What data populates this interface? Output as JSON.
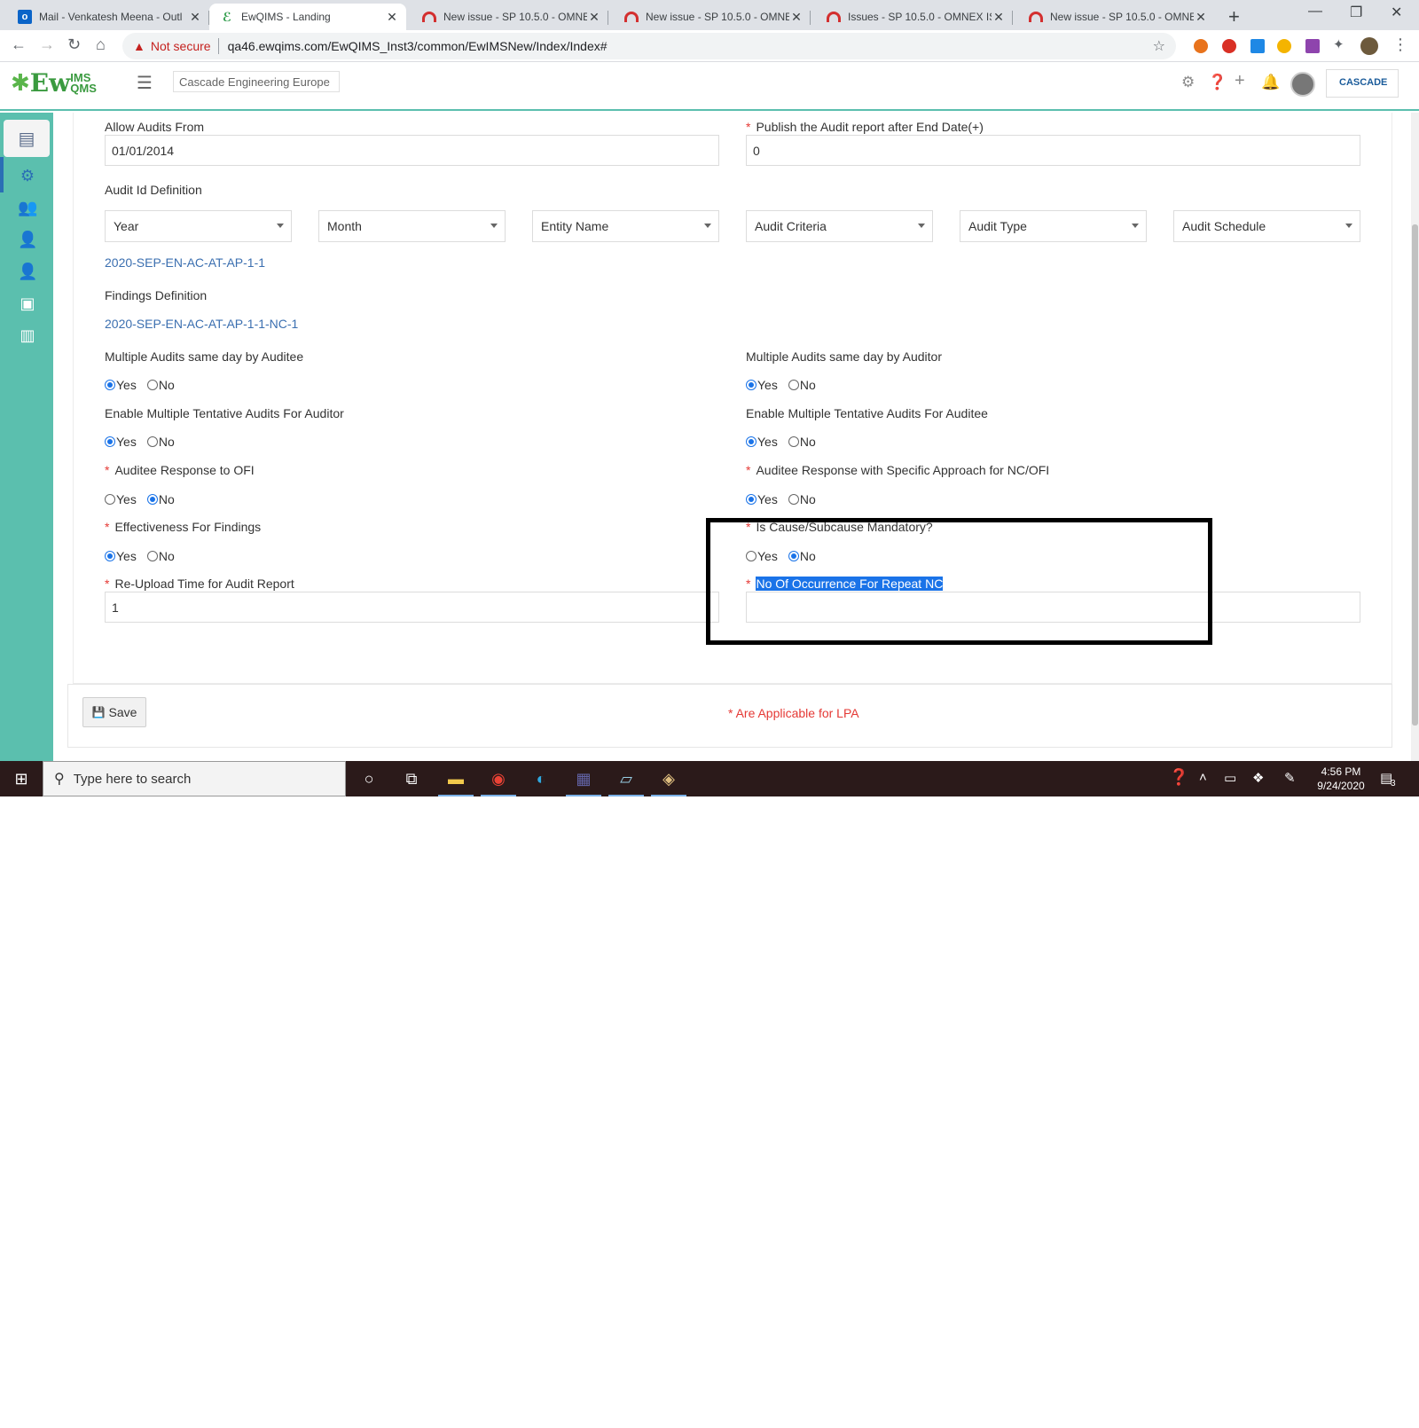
{
  "browser": {
    "tabs": [
      {
        "title": "Mail - Venkatesh Meena - Outl",
        "icon": "outlook-icon"
      },
      {
        "title": "EwQIMS - Landing",
        "icon": "ewqims-icon"
      },
      {
        "title": "New issue - SP 10.5.0 - OMNEX",
        "icon": "omnex-icon"
      },
      {
        "title": "New issue - SP 10.5.0 - OMNEX",
        "icon": "omnex-icon"
      },
      {
        "title": "Issues - SP 10.5.0 - OMNEX ISS",
        "icon": "omnex-icon"
      },
      {
        "title": "New issue - SP 10.5.0 - OMNEX",
        "icon": "omnex-icon"
      }
    ],
    "not_secure": "Not secure",
    "url": "qa46.ewqims.com/EwQIMS_Inst3/common/EwIMSNew/Index/Index#"
  },
  "app": {
    "logo_main": "Ew",
    "logo_top": "IMS",
    "logo_bottom": "QMS",
    "company": "Cascade Engineering Europe",
    "brand": "CASCADE"
  },
  "form": {
    "allow_audits_label": "Allow Audits From",
    "allow_audits_value": "01/01/2014",
    "publish_label": "Publish the Audit report after End Date(+)",
    "publish_value": "0",
    "audit_id_label": "Audit Id Definition",
    "audit_id_selects": [
      "Year",
      "Month",
      "Entity Name",
      "Audit Criteria",
      "Audit Type",
      "Audit Schedule"
    ],
    "audit_id_preview": "2020-SEP-EN-AC-AT-AP-1-1",
    "findings_label": "Findings Definition",
    "findings_preview": "2020-SEP-EN-AC-AT-AP-1-1-NC-1",
    "yes": "Yes",
    "no": "No",
    "multi_auditee_label": "Multiple Audits same day by Auditee",
    "multi_auditor_label": "Multiple Audits same day by Auditor",
    "tentative_auditor_label": "Enable Multiple Tentative Audits For Auditor",
    "tentative_auditee_label": "Enable Multiple Tentative Audits For Auditee",
    "ofi_label": "Auditee Response to OFI",
    "specific_label": "Auditee Response with Specific Approach for NC/OFI",
    "effectiveness_label": "Effectiveness For Findings",
    "cause_label": "Is Cause/Subcause Mandatory?",
    "reupload_label": "Re-Upload Time for Audit Report",
    "reupload_value": "1",
    "occurrence_label": "No Of Occurrence For Repeat NC",
    "occurrence_value": "",
    "required_mark": "*",
    "save_label": "Save",
    "lpa_note": "* Are Applicable for LPA"
  },
  "taskbar": {
    "search_placeholder": "Type here to search",
    "time": "4:56 PM",
    "date": "9/24/2020",
    "notifications": "3"
  },
  "colors": {
    "rail": "#5bbfae",
    "accent": "#1a73e8",
    "required": "#e53935",
    "link": "#3b6fb0"
  }
}
